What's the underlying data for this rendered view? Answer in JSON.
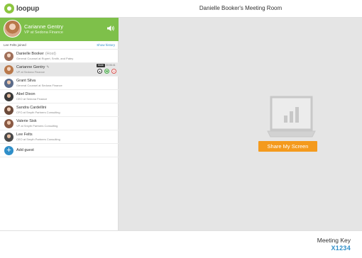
{
  "brand": {
    "logo_text": "loopup",
    "logo_color": "#8cc63f"
  },
  "window": {
    "title": "Danielle Booker's Meeting Room"
  },
  "active_speaker": {
    "name": "Carianne Gentry",
    "role": "VP at Sedona Finance",
    "icon": "speaker-volume-icon",
    "background_color": "#7ec04a"
  },
  "activity": {
    "joined_text": "Lee Felts joined",
    "history_label": "Show history"
  },
  "participants": [
    {
      "name": "Danielle Booker",
      "tag": "(Host)",
      "subtitle": "General Counsel at Rupert, Smith, and Patey",
      "avatar_color": "#a0705a"
    },
    {
      "name": "Carianne Gentry",
      "subtitle": "VP at Sedona Finance",
      "avatar_color": "#b9784a",
      "selected": true,
      "controls": {
        "mute_tooltip": "Mute",
        "duration": "00:06:41",
        "mute_icon": "microphone-icon",
        "audio_icon": "phone-icon",
        "drop_icon": "hang-up-icon"
      }
    },
    {
      "name": "Grant Silva",
      "subtitle": "General Counsel at Sedona Finance",
      "avatar_color": "#5a6b8a"
    },
    {
      "name": "Abel Dixon",
      "subtitle": "CEO at Sedona Finance",
      "avatar_color": "#3a3a3a"
    },
    {
      "name": "Sandra Cardellini",
      "subtitle": "CFO at Smyth Partners Consulting",
      "avatar_color": "#6b4a3a"
    },
    {
      "name": "Valerie Sisk",
      "subtitle": "VP at Smyth Partners Consulting",
      "avatar_color": "#8a5a44"
    },
    {
      "name": "Lee Felts",
      "subtitle": "CEO at Smyth Partners Consulting",
      "avatar_color": "#4a4a4a"
    }
  ],
  "add_guest": {
    "label": "Add guest",
    "icon": "plus-icon"
  },
  "share": {
    "button_label": "Share My Screen",
    "icon": "screen-share-icon",
    "button_color": "#f49a1d"
  },
  "meeting_key": {
    "label": "Meeting Key",
    "value": "X1234"
  },
  "colors": {
    "accent_blue": "#2f8fc9",
    "green": "#7ec04a",
    "orange": "#f49a1d"
  }
}
